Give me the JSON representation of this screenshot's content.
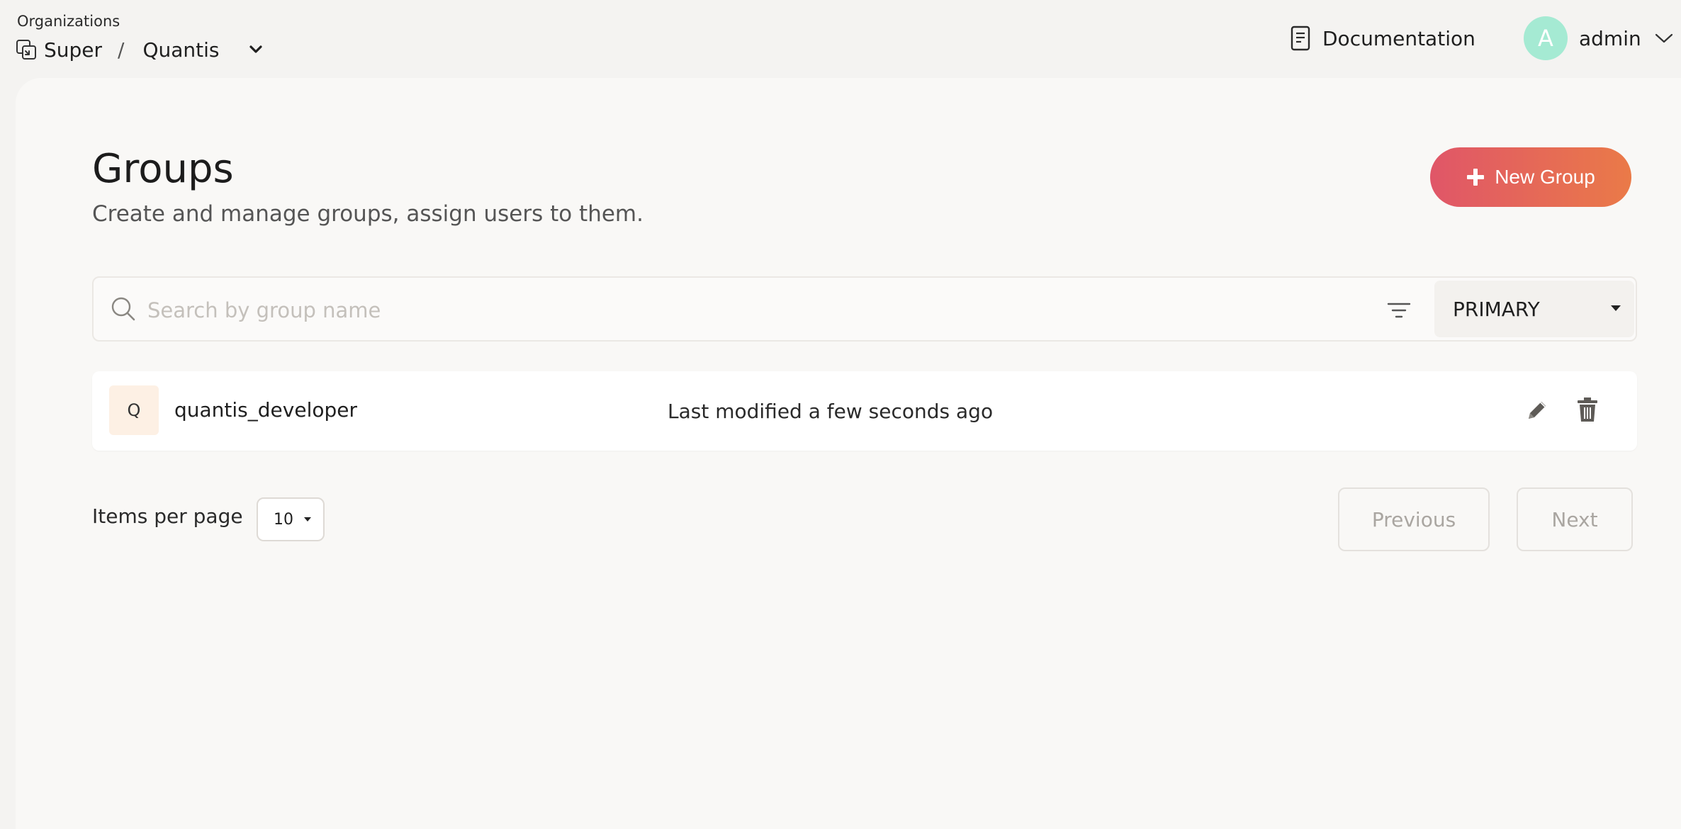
{
  "header": {
    "org_label": "Organizations",
    "org_root": "Super",
    "org_separator": "/",
    "org_current": "Quantis",
    "documentation_label": "Documentation",
    "user": {
      "avatar_letter": "A",
      "avatar_color": "#a5ead3",
      "name": "admin"
    }
  },
  "page": {
    "title": "Groups",
    "subtitle": "Create and manage groups, assign users to them.",
    "new_button_label": "New Group",
    "accent_gradient": [
      "#e05668",
      "#ea7a48"
    ]
  },
  "search": {
    "placeholder": "Search by group name",
    "value": "",
    "domain_selected": "PRIMARY"
  },
  "groups": [
    {
      "initial": "Q",
      "name": "quantis_developer",
      "modified": "Last modified a few seconds ago"
    }
  ],
  "pagination": {
    "items_per_page_label": "Items per page",
    "items_per_page": "10",
    "previous_label": "Previous",
    "next_label": "Next"
  },
  "icons": [
    "org-switch-icon",
    "chevron-down-icon",
    "document-icon",
    "search-icon",
    "filter-icon",
    "caret-down-icon",
    "plus-icon",
    "pencil-icon",
    "trash-icon"
  ]
}
